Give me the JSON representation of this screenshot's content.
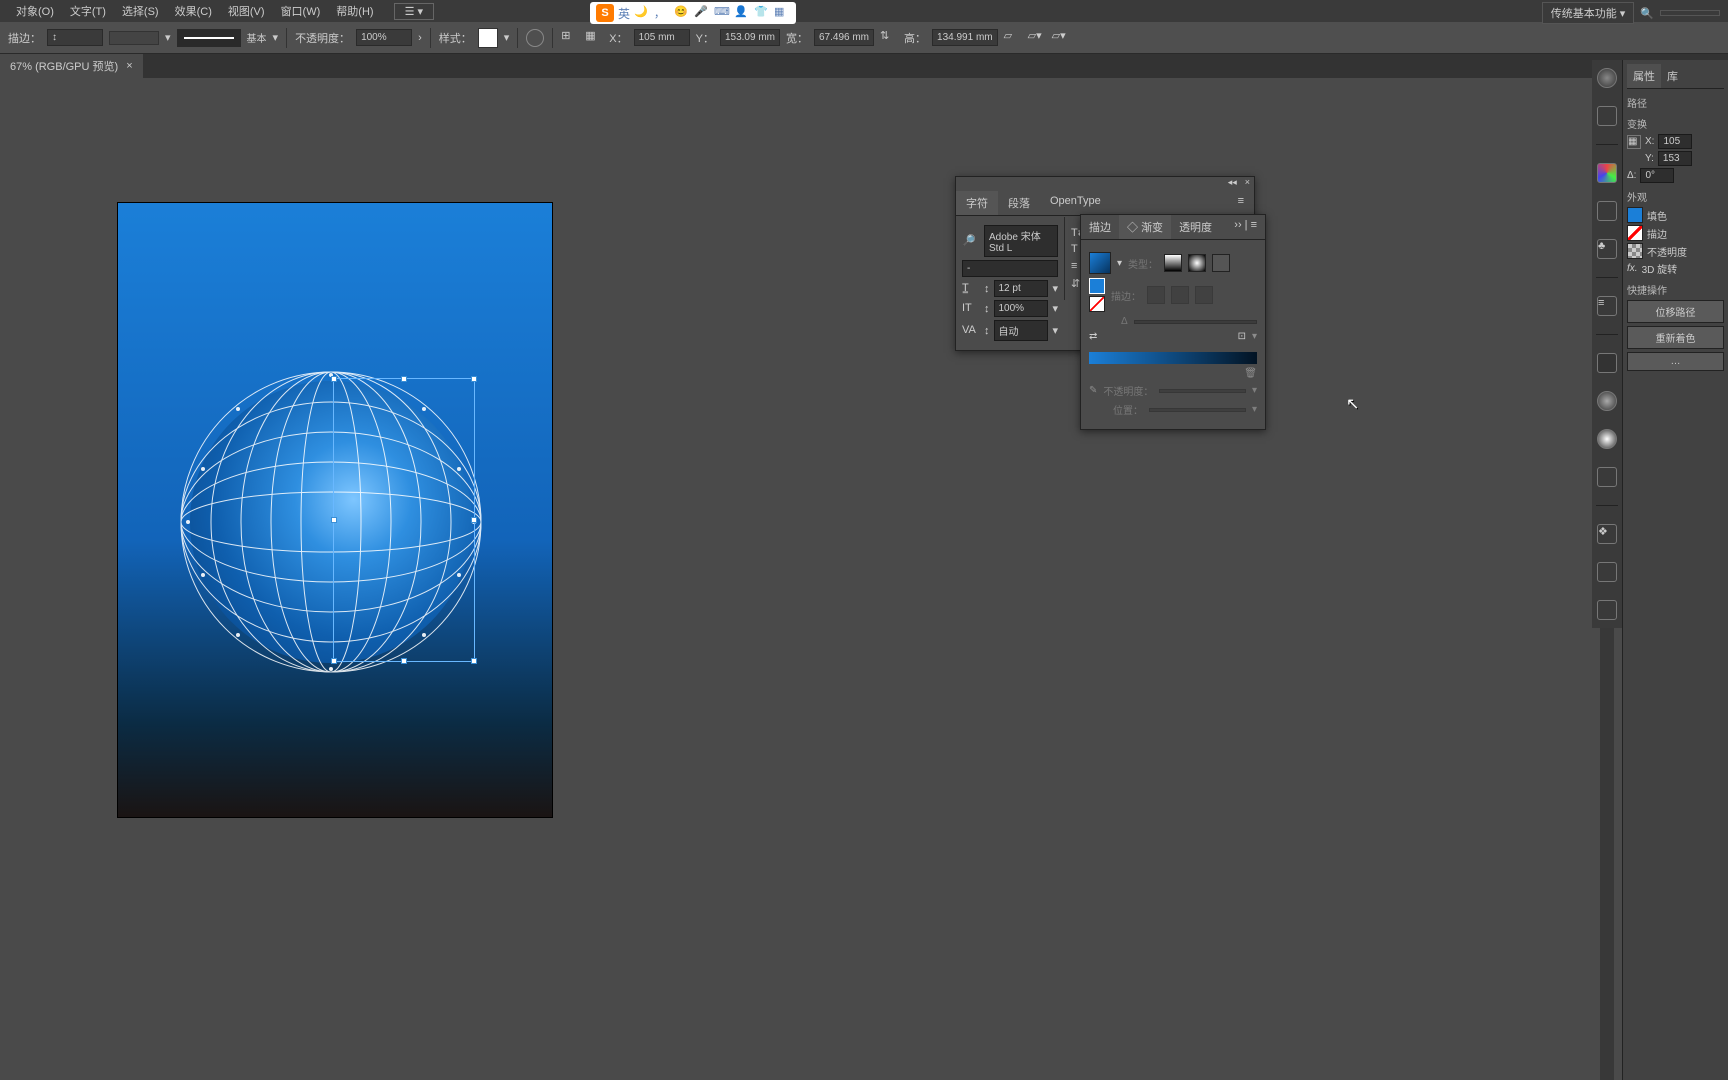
{
  "menu": {
    "items": [
      "对象(O)",
      "文字(T)",
      "选择(S)",
      "效果(C)",
      "视图(V)",
      "窗口(W)",
      "帮助(H)"
    ]
  },
  "os_tray": {
    "ime": "英"
  },
  "workspace": {
    "label": "传统基本功能",
    "search_placeholder": "搜索"
  },
  "optbar": {
    "stroke_label": "描边：",
    "stroke_style": "基本",
    "opacity_label": "不透明度：",
    "opacity_value": "100%",
    "style_label": "样式：",
    "x_label": "X：",
    "x_value": "105 mm",
    "y_label": "Y：",
    "y_value": "153.09 mm",
    "w_label": "宽：",
    "w_value": "67.496 mm",
    "h_label": "高：",
    "h_value": "134.991 mm"
  },
  "doctab": {
    "title": "67% (RGB/GPU 预览)",
    "close": "×"
  },
  "char_panel": {
    "tabs": [
      "字符",
      "段落",
      "OpenType"
    ],
    "font": "Adobe 宋体 Std L",
    "style": "-",
    "size": "12 pt",
    "leading_auto": "100%",
    "kerning": "自动"
  },
  "grad_panel": {
    "tabs": [
      "描边",
      "渐变",
      "透明度"
    ],
    "type_label": "类型：",
    "stroke_label": "描边：",
    "angle_label": "Δ",
    "opacity_label": "不透明度：",
    "location_label": "位置："
  },
  "props": {
    "tabs": [
      "属性",
      "库"
    ],
    "path_label": "路径",
    "transform_label": "变换",
    "x_label": "X:",
    "x_value": "105",
    "y_label": "Y:",
    "y_value": "153",
    "rot_label": "Δ:",
    "rot_value": "0°",
    "appearance_label": "外观",
    "fill_label": "填色",
    "stroke_label": "描边",
    "opacity_label": "不透明度",
    "fx_label": "3D 旋转",
    "quick_label": "快捷操作",
    "btn_offset": "位移路径",
    "btn_recolor": "重新着色"
  }
}
